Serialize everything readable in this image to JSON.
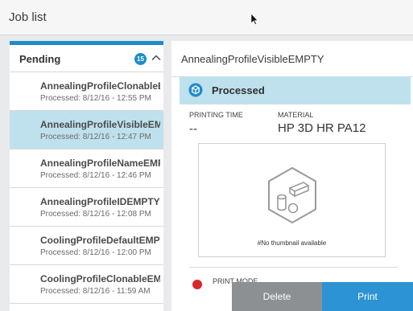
{
  "window": {
    "title": "Job list"
  },
  "list": {
    "header": {
      "label": "Pending",
      "count": "15"
    },
    "items": [
      {
        "name": "AnnealingProfileClonableEM...",
        "status": "Processed: 8/12/16 - 12:55 PM"
      },
      {
        "name": "AnnealingProfileVisibleEMPTY",
        "status": "Processed: 8/12/16 - 12:47 PM"
      },
      {
        "name": "AnnealingProfileNameEMPTY",
        "status": "Processed: 8/12/16 - 12:46 PM"
      },
      {
        "name": "AnnealingProfileIDEMPTY",
        "status": "Processed: 8/12/16 - 12:08 PM"
      },
      {
        "name": "CoolingProfileDefaultEMPTY",
        "status": "Processed: 8/12/16 - 12:00 PM"
      },
      {
        "name": "CoolingProfileClonableEMPTY",
        "status": "Processed: 8/12/16 - 11:59 AM"
      }
    ]
  },
  "detail": {
    "title": "AnnealingProfileVisibleEMPTY",
    "status": "Processed",
    "printing_time_label": "PRINTING TIME",
    "printing_time_value": "--",
    "material_label": "MATERIAL",
    "material_value": "HP 3D HR PA12",
    "thumbnail_text": "#No thumbnail available",
    "print_mode_label": "PRINT MODE"
  },
  "actions": {
    "delete_label": "Delete",
    "print_label": "Print"
  },
  "colors": {
    "accent": "#1e8cc9",
    "selected": "#bfe1ee",
    "print_button": "#2c93d4",
    "delete_button": "#8c9093",
    "alert": "#d8262e"
  }
}
